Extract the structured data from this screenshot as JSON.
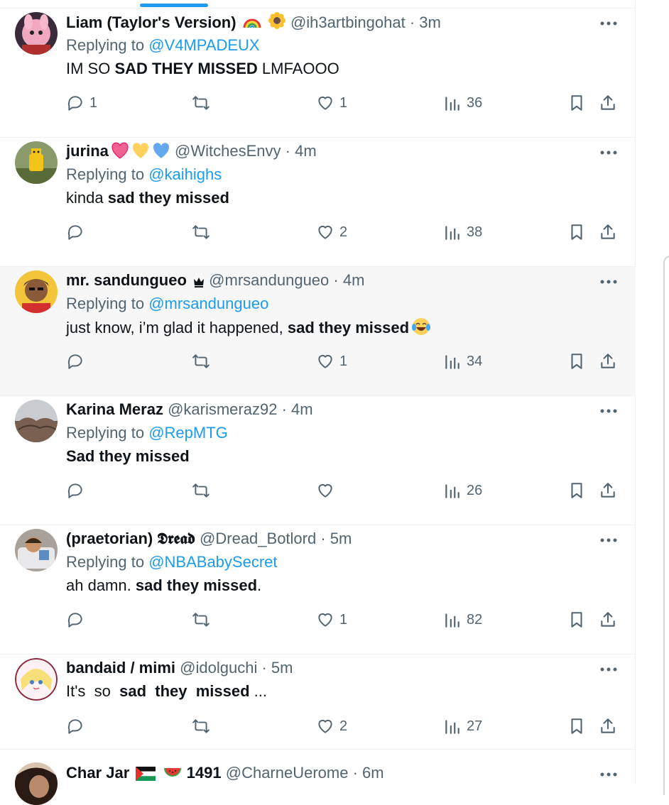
{
  "colors": {
    "accent": "#1d9bf0",
    "muted": "#536471",
    "text": "#0f1419",
    "highlight_bg": "#f7f7f7"
  },
  "tweets": [
    {
      "name": "Liam (Taylor's Version)",
      "name_emoji": [
        "rainbow-icon",
        "sunflower-icon"
      ],
      "handle": "@ih3artbingohat",
      "time": "· 3m",
      "reply_prefix": "Replying to",
      "reply_to": "@V4MPADEUX",
      "body": [
        {
          "t": "IM SO ",
          "b": false
        },
        {
          "t": "SAD THEY MISSED",
          "b": true
        },
        {
          "t": " LMFAOOO",
          "b": false
        }
      ],
      "replies": "1",
      "retweets": "",
      "likes": "1",
      "views": "36"
    },
    {
      "name": "jurina",
      "name_emoji": [
        "heart-pink-icon",
        "heart-yellow-icon",
        "heart-blue-icon"
      ],
      "handle": "@WitchesEnvy",
      "time": "· 4m",
      "reply_prefix": "Replying to",
      "reply_to": "@kaihighs",
      "body": [
        {
          "t": "kinda ",
          "b": false
        },
        {
          "t": "sad they missed",
          "b": true
        }
      ],
      "replies": "",
      "retweets": "",
      "likes": "2",
      "views": "38"
    },
    {
      "name": "mr. sandungueo",
      "name_emoji": [
        "crown-icon"
      ],
      "handle": "@mrsandungueo",
      "time": "· 4m",
      "reply_prefix": "Replying to",
      "reply_to": "@mrsandungueo",
      "body": [
        {
          "t": "just know, i’m glad it happened, ",
          "b": false
        },
        {
          "t": "sad they missed",
          "b": true
        }
      ],
      "body_emoji": "laughing-crying-icon",
      "replies": "",
      "retweets": "",
      "likes": "1",
      "views": "34",
      "highlight": true
    },
    {
      "name": "Karina Meraz",
      "name_emoji": [],
      "handle": "@karismeraz92",
      "time": "· 4m",
      "reply_prefix": "Replying to",
      "reply_to": "@RepMTG",
      "body": [
        {
          "t": "Sad they missed",
          "b": true
        }
      ],
      "replies": "",
      "retweets": "",
      "likes": "",
      "views": "26"
    },
    {
      "name": "(praetorian) 𝕯𝖗𝖊𝖆𝖉",
      "name_emoji": [],
      "handle": "@Dread_Botlord",
      "time": "· 5m",
      "reply_prefix": "Replying to",
      "reply_to": "@NBABabySecret",
      "body": [
        {
          "t": "ah damn. ",
          "b": false
        },
        {
          "t": "sad they missed",
          "b": true
        },
        {
          "t": ".",
          "b": false
        }
      ],
      "replies": "",
      "retweets": "",
      "likes": "1",
      "views": "82"
    },
    {
      "name": "bandaid / mimi",
      "name_emoji": [],
      "handle": "@idolguchi",
      "time": "· 5m",
      "reply_prefix": "",
      "reply_to": "",
      "body": [
        {
          "t": "It's  so  ",
          "b": false
        },
        {
          "t": "sad  they  missed",
          "b": true
        },
        {
          "t": " ...",
          "b": false
        }
      ],
      "replies": "",
      "retweets": "",
      "likes": "2",
      "views": "27"
    },
    {
      "name": "Char Jar",
      "name_emoji": [
        "palestine-flag-icon",
        "watermelon-icon"
      ],
      "name_suffix": "1491",
      "handle": "@CharneUerome",
      "time": "· 6m",
      "reply_prefix": "",
      "reply_to": "",
      "body": [],
      "replies": "",
      "retweets": "",
      "likes": "",
      "views": ""
    }
  ]
}
